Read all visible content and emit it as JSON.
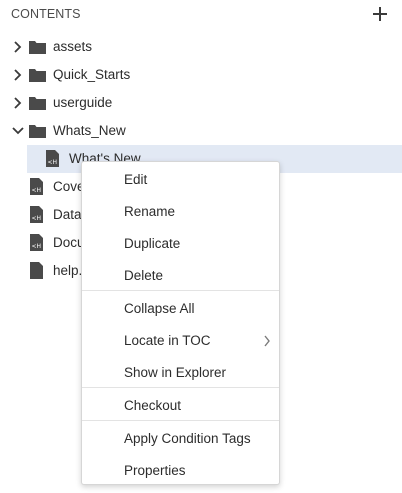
{
  "panel": {
    "title": "CONTENTS",
    "add_icon": "plus-icon"
  },
  "tree": {
    "items": [
      {
        "label": "assets",
        "type": "folder",
        "expanded": false
      },
      {
        "label": "Quick_Starts",
        "type": "folder",
        "expanded": false
      },
      {
        "label": "userguide",
        "type": "folder",
        "expanded": false
      },
      {
        "label": "Whats_New",
        "type": "folder",
        "expanded": true
      },
      {
        "label": "What's New",
        "type": "ditamap",
        "selected": true
      },
      {
        "label": "Cove",
        "type": "ditamap"
      },
      {
        "label": "Data",
        "type": "ditamap"
      },
      {
        "label": "Docu",
        "type": "ditamap"
      },
      {
        "label": "help.",
        "type": "file"
      }
    ]
  },
  "context_menu": {
    "items": [
      {
        "label": "Edit"
      },
      {
        "label": "Rename"
      },
      {
        "label": "Duplicate"
      },
      {
        "label": "Delete"
      },
      {
        "label": "Collapse All"
      },
      {
        "label": "Locate in TOC",
        "submenu": true
      },
      {
        "label": "Show in Explorer"
      },
      {
        "label": "Checkout"
      },
      {
        "label": "Apply Condition Tags"
      },
      {
        "label": "Properties"
      }
    ]
  },
  "colors": {
    "selected_row": "#e2e9f4",
    "text": "#2c2c2c",
    "icon": "#4a4a4a"
  }
}
